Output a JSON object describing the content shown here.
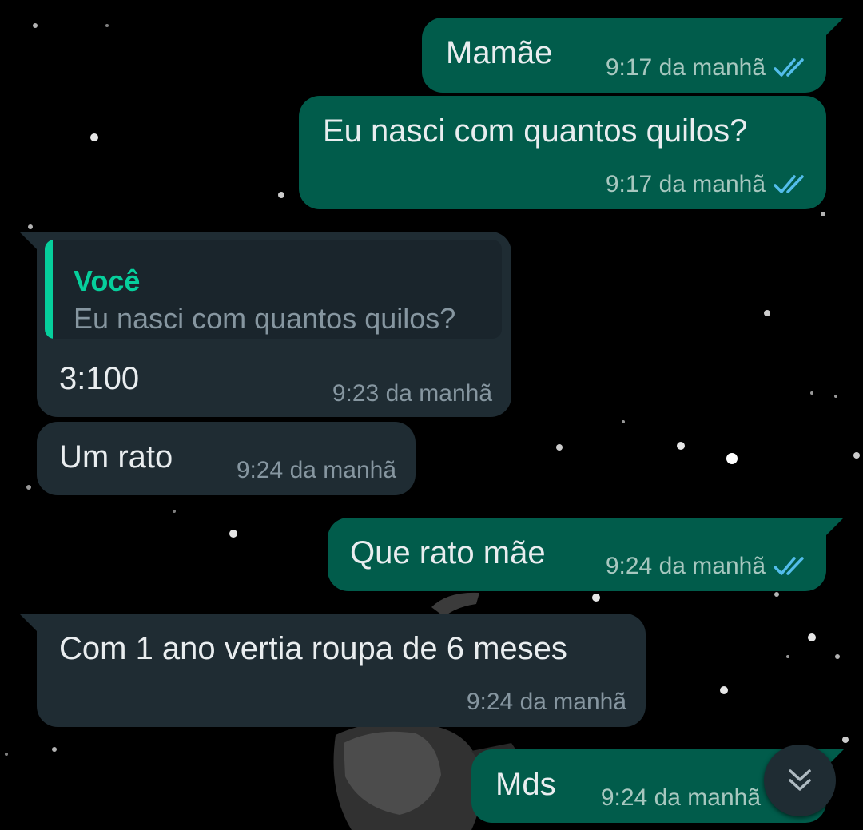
{
  "theme": {
    "outgoing_bubble": "#015c4b",
    "incoming_bubble": "#1f2c33",
    "quote_accent": "#06cf9c",
    "read_tick_color": "#53bdeb",
    "background": "#000000"
  },
  "messages": [
    {
      "direction": "outgoing",
      "text": "Mamãe",
      "time": "9:17 da manhã",
      "status": "read-double-tick-icon"
    },
    {
      "direction": "outgoing",
      "text": "Eu nasci com quantos quilos?",
      "time": "9:17 da manhã",
      "status": "read-double-tick-icon"
    },
    {
      "direction": "incoming",
      "quote": {
        "author": "Você",
        "text": "Eu nasci com quantos quilos?"
      },
      "text": "3:100",
      "time": "9:23 da manhã"
    },
    {
      "direction": "incoming",
      "text": "Um rato",
      "time": "9:24 da manhã"
    },
    {
      "direction": "outgoing",
      "text": "Que rato mãe",
      "time": "9:24 da manhã",
      "status": "read-double-tick-icon"
    },
    {
      "direction": "incoming",
      "text": "Com 1 ano vertia roupa de 6 meses",
      "time": "9:24 da manhã"
    },
    {
      "direction": "outgoing",
      "text": "Mds",
      "time": "9:24 da manhã",
      "status": "read-double-tick-icon"
    }
  ],
  "scroll_button": {
    "icon": "double-chevron-down-icon"
  },
  "wallpaper": {
    "description_icon": "starfield-wallpaper"
  }
}
